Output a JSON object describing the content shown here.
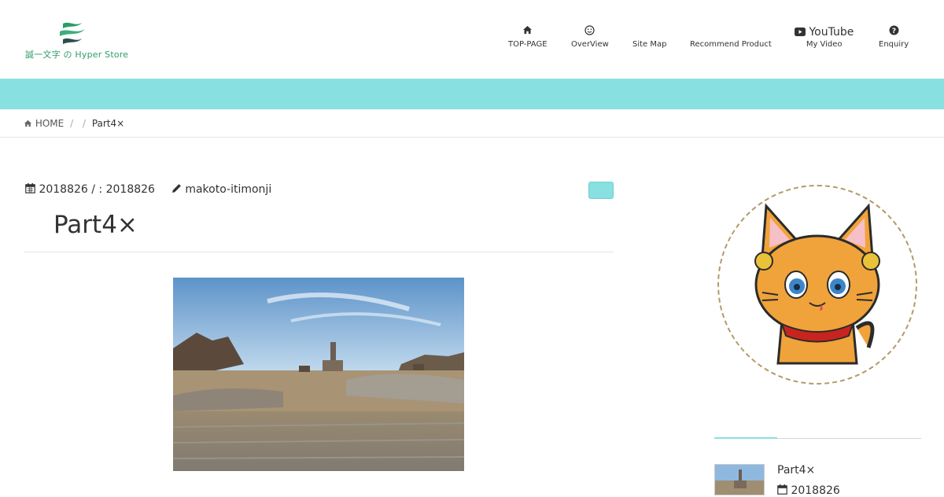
{
  "brand": {
    "logo_text": "誠一文字 の Hyper Store"
  },
  "nav": [
    {
      "icon": "home-icon",
      "glyph": "⌂",
      "label": "TOP-PAGE"
    },
    {
      "icon": "smile-icon",
      "glyph": "☺",
      "label": "OverView"
    },
    {
      "icon": "",
      "glyph": "",
      "label": "Site Map"
    },
    {
      "icon": "",
      "glyph": "",
      "label": "Recommend Product"
    },
    {
      "icon": "youtube-icon",
      "glyph": "▶",
      "top_label": "YouTube",
      "label": "My Video"
    },
    {
      "icon": "question-icon",
      "glyph": "?",
      "label": "Enquiry"
    }
  ],
  "breadcrumb": {
    "home": "HOME",
    "sep1": "/",
    "sep2": "/",
    "current": "Part4×"
  },
  "post": {
    "date": "2018826",
    "date_sep": "/  :",
    "updated": "2018826",
    "author": "makoto-itimonji",
    "title": "Part4×"
  },
  "sidebar": {
    "recent_title": "Part4×",
    "recent_date": "2018826"
  },
  "colors": {
    "accent": "#88e1e0",
    "logo_green": "#2e9c6a"
  }
}
